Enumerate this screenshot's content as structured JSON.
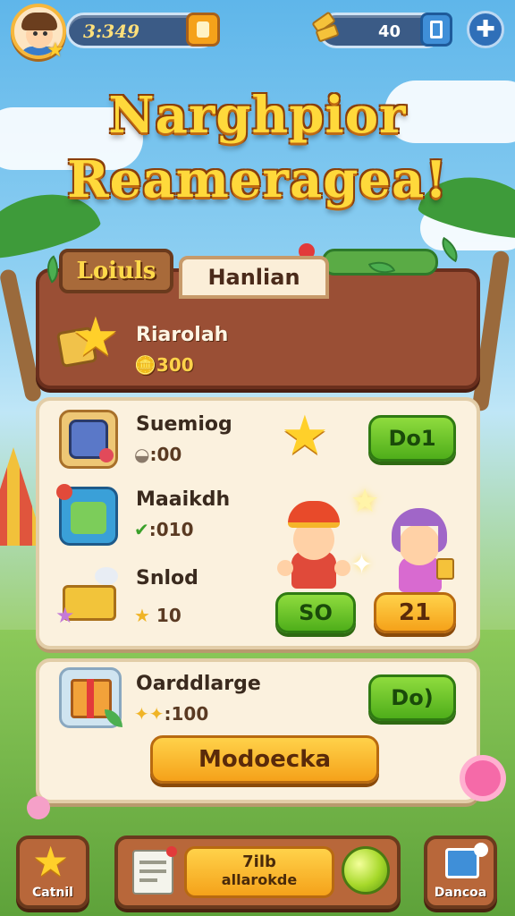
{
  "top_bar": {
    "coins": "3:349",
    "gems": "40"
  },
  "title": {
    "line1": "Narghpior",
    "line2": "Reameragea!"
  },
  "tabs": {
    "tab1": "Loiuls",
    "tab2": "Hanlian"
  },
  "featured": {
    "name": "Riarolah",
    "price": "300"
  },
  "items": [
    {
      "name": "Suemiog",
      "price": ":00",
      "button": "Do1"
    },
    {
      "name": "Maaikdh",
      "price": ":010"
    },
    {
      "name": "Snlod",
      "price": "10"
    }
  ],
  "characters": {
    "left_button": "SO",
    "right_button": "21"
  },
  "offer": {
    "name": "Oarddlarge",
    "price": ":100",
    "button": "Do)",
    "big_button": "Modoecka"
  },
  "bottom_bar": {
    "left_label": "Catnil",
    "center_line1": "7ilb",
    "center_line2": "allarokde",
    "right_label": "Dancoa"
  },
  "colors": {
    "title_fill": "#ffd93b",
    "panel_brown": "#9a4f35",
    "panel_cream": "#fbf1de",
    "button_green": "#4fae1a",
    "button_orange": "#f5a21a"
  }
}
